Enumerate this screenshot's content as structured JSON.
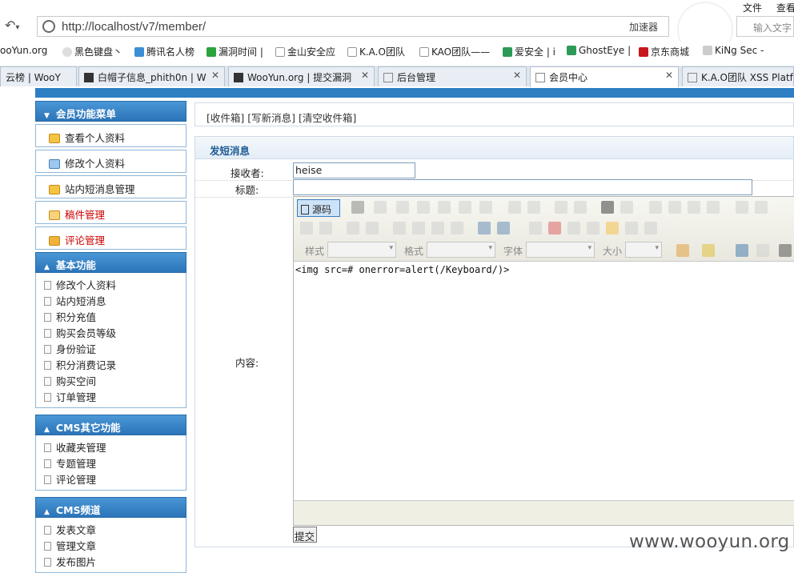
{
  "browser": {
    "url": "http://localhost/v7/member/",
    "accelerator": "加速器",
    "menu": [
      "文件",
      "查看"
    ],
    "search_placeholder": "输入文字"
  },
  "bookmarks": [
    "ooYun.org",
    "黑色键盘丶",
    "腾讯名人榜",
    "漏洞时间 |",
    "金山安全应",
    "K.A.O团队",
    "KAO团队——",
    "爱安全 | i",
    "GhostEye |",
    "京东商城",
    "KiNg Sec -"
  ],
  "tabs": [
    {
      "title": "云榜 | WooY"
    },
    {
      "title": "白帽子信息_phith0n | W"
    },
    {
      "title": "WooYun.org | 提交漏洞"
    },
    {
      "title": "后台管理"
    },
    {
      "title": "会员中心"
    },
    {
      "title": "K.A.O团队 XSS Platfo"
    }
  ],
  "sidebar": {
    "member_menu_title": "会员功能菜单",
    "member_buttons": [
      "查看个人资料",
      "修改个人资料",
      "站内短消息管理",
      "稿件管理",
      "评论管理"
    ],
    "basic_title": "基本功能",
    "basic_items": [
      "修改个人资料",
      "站内短消息",
      "积分充值",
      "购买会员等级",
      "身份验证",
      "积分消费记录",
      "购买空间",
      "订单管理"
    ],
    "cms_other_title": "CMS其它功能",
    "cms_other_items": [
      "收藏夹管理",
      "专题管理",
      "评论管理"
    ],
    "cms_channel_title": "CMS频道",
    "cms_channel_items": [
      "发表文章",
      "管理文章",
      "发布图片"
    ]
  },
  "breadcrumb": "[收件箱] [写新消息] [清空收件箱]",
  "form": {
    "panel_title": "发短消息",
    "receiver_label": "接收者:",
    "receiver_value": "heise",
    "title_label": "标题:",
    "content_label": "内容:",
    "source_button": "源码",
    "style_label": "样式",
    "format_label": "格式",
    "font_label": "字体",
    "size_label": "大小",
    "editor_content": "<img src=# onerror=alert(/Keyboard/)>",
    "submit_label": "提交"
  },
  "watermark": "www.wooyun.org"
}
